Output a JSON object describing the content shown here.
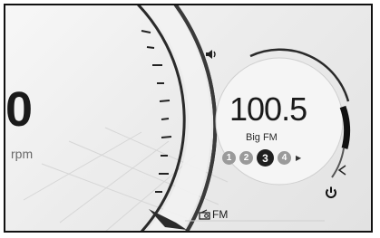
{
  "tachometer": {
    "value": "0",
    "unit": "rpm"
  },
  "radio": {
    "frequency": "100.5",
    "station": "Big FM",
    "band": "FM",
    "presets": [
      "1",
      "2",
      "3",
      "4"
    ],
    "active_preset": "3"
  },
  "icons": {
    "volume": "speaker-icon",
    "volume_down": "volume-triangle-icon",
    "power": "power-icon",
    "radio_source": "radio-icon",
    "next_preset": "play-arrow-icon"
  },
  "colors": {
    "active_preset": "#1f1f1f",
    "inactive_preset": "#9a9a9a",
    "text": "#1a1a1a"
  }
}
